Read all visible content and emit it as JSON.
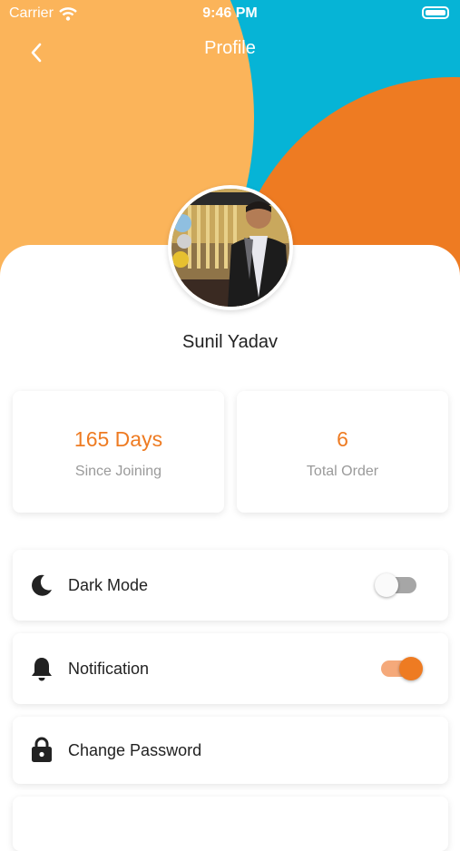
{
  "status_bar": {
    "carrier": "Carrier",
    "time": "9:46 PM"
  },
  "header": {
    "title": "Profile",
    "back_icon": "chevron-left-icon"
  },
  "colors": {
    "accent": "#ee7b22",
    "cyan": "#06b4d6",
    "light_orange": "#fbb45a",
    "orange": "#ee7b22"
  },
  "profile": {
    "name": "Sunil Yadav"
  },
  "stats": [
    {
      "value": "165 Days",
      "label": "Since Joining"
    },
    {
      "value": "6",
      "label": "Total Order"
    }
  ],
  "settings": [
    {
      "label": "Dark Mode",
      "icon": "moon-icon",
      "toggle": false
    },
    {
      "label": "Notification",
      "icon": "bell-icon",
      "toggle": true
    },
    {
      "label": "Change Password",
      "icon": "lock-icon"
    }
  ]
}
